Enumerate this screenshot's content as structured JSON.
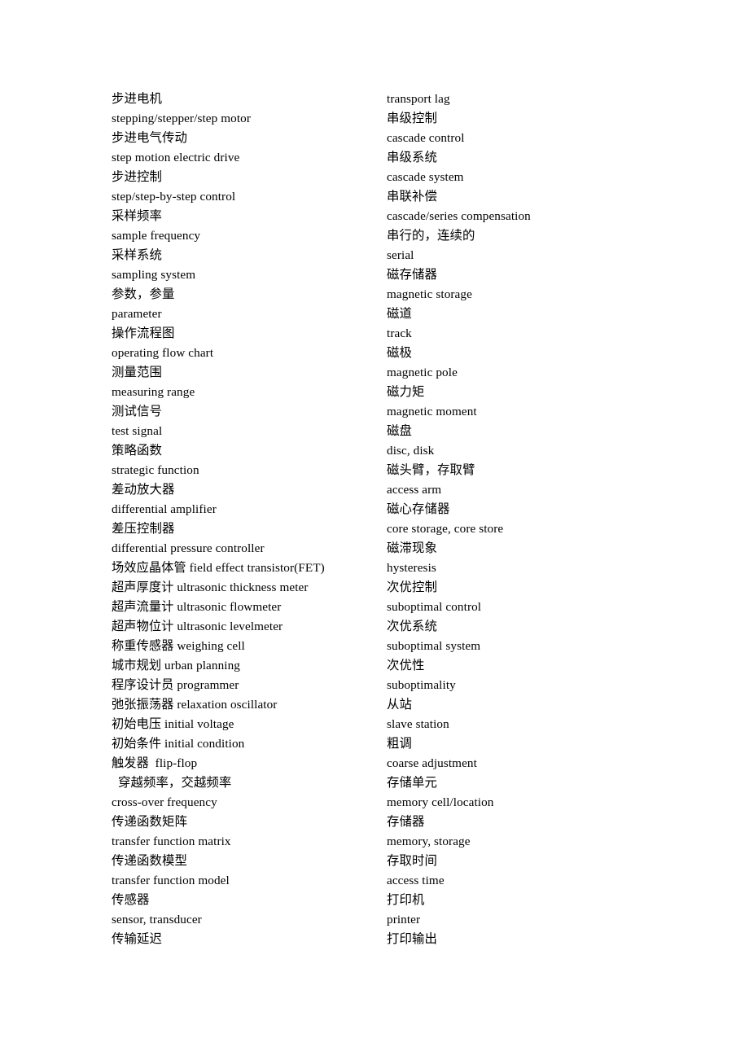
{
  "document": {
    "type": "bilingual-glossary-page",
    "background_color": "#ffffff",
    "text_color": "#000000",
    "columns": 2
  },
  "left_column": {
    "name": "left-glossary-column",
    "lines": [
      {
        "text": "步进电机",
        "lang": "zh"
      },
      {
        "text": "stepping/stepper/step motor",
        "lang": "en"
      },
      {
        "text": "步进电气传动",
        "lang": "zh"
      },
      {
        "text": "step motion electric drive",
        "lang": "en"
      },
      {
        "text": "步进控制",
        "lang": "zh"
      },
      {
        "text": "step/step-by-step control",
        "lang": "en"
      },
      {
        "text": "采样频率",
        "lang": "zh"
      },
      {
        "text": "sample frequency",
        "lang": "en"
      },
      {
        "text": "采样系统",
        "lang": "zh"
      },
      {
        "text": "sampling system",
        "lang": "en"
      },
      {
        "text": "参数，参量",
        "lang": "zh"
      },
      {
        "text": "parameter",
        "lang": "en"
      },
      {
        "text": "操作流程图",
        "lang": "zh"
      },
      {
        "text": "operating flow chart",
        "lang": "en"
      },
      {
        "text": "测量范围",
        "lang": "zh"
      },
      {
        "text": "measuring range",
        "lang": "en"
      },
      {
        "text": "测试信号",
        "lang": "zh"
      },
      {
        "text": "test signal",
        "lang": "en"
      },
      {
        "text": "策略函数",
        "lang": "zh"
      },
      {
        "text": "strategic function",
        "lang": "en"
      },
      {
        "text": "差动放大器",
        "lang": "zh"
      },
      {
        "text": "differential amplifier",
        "lang": "en"
      },
      {
        "text": "差压控制器",
        "lang": "zh"
      },
      {
        "text": "differential pressure controller",
        "lang": "en"
      },
      {
        "text": "场效应晶体管 field effect transistor(FET)",
        "lang": "mixed"
      },
      {
        "text": "超声厚度计 ultrasonic thickness meter",
        "lang": "mixed"
      },
      {
        "text": "超声流量计 ultrasonic flowmeter",
        "lang": "mixed"
      },
      {
        "text": "超声物位计 ultrasonic levelmeter",
        "lang": "mixed"
      },
      {
        "text": "称重传感器 weighing cell",
        "lang": "mixed"
      },
      {
        "text": "城市规划 urban planning",
        "lang": "mixed"
      },
      {
        "text": "程序设计员 programmer",
        "lang": "mixed"
      },
      {
        "text": "弛张振荡器 relaxation oscillator",
        "lang": "mixed"
      },
      {
        "text": "初始电压 initial voltage",
        "lang": "mixed"
      },
      {
        "text": "初始条件 initial condition",
        "lang": "mixed"
      },
      {
        "text": "触发器  flip-flop",
        "lang": "mixed"
      },
      {
        "text": "穿越频率，交越频率",
        "lang": "zh",
        "indent": true
      },
      {
        "text": "cross-over frequency",
        "lang": "en"
      },
      {
        "text": "传递函数矩阵",
        "lang": "zh"
      },
      {
        "text": "transfer function matrix",
        "lang": "en"
      },
      {
        "text": "传递函数模型",
        "lang": "zh"
      },
      {
        "text": "transfer function model",
        "lang": "en"
      },
      {
        "text": "传感器",
        "lang": "zh"
      },
      {
        "text": "sensor, transducer",
        "lang": "en"
      },
      {
        "text": "传输延迟",
        "lang": "zh"
      }
    ]
  },
  "right_column": {
    "name": "right-glossary-column",
    "lines": [
      {
        "text": "transport lag",
        "lang": "en"
      },
      {
        "text": "串级控制",
        "lang": "zh"
      },
      {
        "text": "cascade control",
        "lang": "en"
      },
      {
        "text": "串级系统",
        "lang": "zh"
      },
      {
        "text": "cascade system",
        "lang": "en"
      },
      {
        "text": "串联补偿",
        "lang": "zh"
      },
      {
        "text": "cascade/series compensation",
        "lang": "en"
      },
      {
        "text": "串行的，连续的",
        "lang": "zh"
      },
      {
        "text": "serial",
        "lang": "en"
      },
      {
        "text": "磁存储器",
        "lang": "zh"
      },
      {
        "text": "magnetic storage",
        "lang": "en"
      },
      {
        "text": "磁道",
        "lang": "zh"
      },
      {
        "text": "track",
        "lang": "en"
      },
      {
        "text": "磁极",
        "lang": "zh"
      },
      {
        "text": "magnetic pole",
        "lang": "en"
      },
      {
        "text": "磁力矩",
        "lang": "zh"
      },
      {
        "text": "magnetic moment",
        "lang": "en"
      },
      {
        "text": "磁盘",
        "lang": "zh"
      },
      {
        "text": "disc, disk",
        "lang": "en"
      },
      {
        "text": "磁头臂，存取臂",
        "lang": "zh"
      },
      {
        "text": "access arm",
        "lang": "en"
      },
      {
        "text": "磁心存储器",
        "lang": "zh"
      },
      {
        "text": "core storage, core store",
        "lang": "en"
      },
      {
        "text": "磁滞现象",
        "lang": "zh"
      },
      {
        "text": "hysteresis",
        "lang": "en"
      },
      {
        "text": "次优控制",
        "lang": "zh"
      },
      {
        "text": "suboptimal control",
        "lang": "en"
      },
      {
        "text": "次优系统",
        "lang": "zh"
      },
      {
        "text": "suboptimal system",
        "lang": "en"
      },
      {
        "text": "次优性",
        "lang": "zh"
      },
      {
        "text": "suboptimality",
        "lang": "en"
      },
      {
        "text": "从站",
        "lang": "zh"
      },
      {
        "text": "slave station",
        "lang": "en"
      },
      {
        "text": "粗调",
        "lang": "zh"
      },
      {
        "text": "coarse adjustment",
        "lang": "en"
      },
      {
        "text": "存储单元",
        "lang": "zh"
      },
      {
        "text": "memory cell/location",
        "lang": "en"
      },
      {
        "text": "存储器",
        "lang": "zh"
      },
      {
        "text": "memory, storage",
        "lang": "en"
      },
      {
        "text": "存取时间",
        "lang": "zh"
      },
      {
        "text": "access time",
        "lang": "en"
      },
      {
        "text": "打印机",
        "lang": "zh"
      },
      {
        "text": "printer",
        "lang": "en"
      },
      {
        "text": "打印输出",
        "lang": "zh"
      }
    ]
  }
}
